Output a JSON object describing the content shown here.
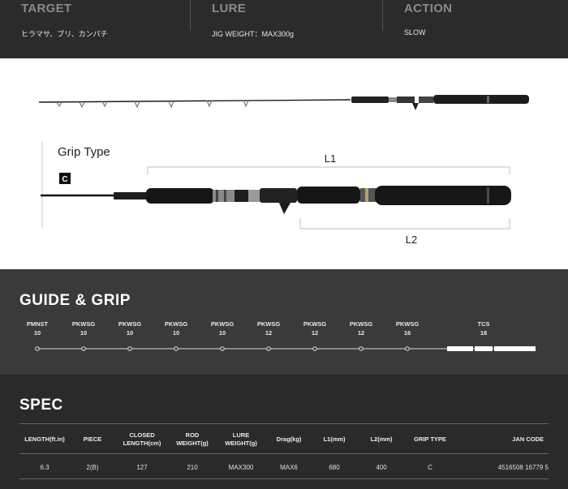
{
  "top": {
    "target": {
      "heading": "TARGET",
      "value": "ヒラマサ、ブリ、カンパチ"
    },
    "lure": {
      "heading": "LURE",
      "value": "JIG WEIGHT：MAX300g"
    },
    "action": {
      "heading": "ACTION",
      "value": "SLOW"
    }
  },
  "rod": {
    "grip_type_label": "Grip Type",
    "grip_type_code": "C",
    "l1_label": "L1",
    "l2_label": "L2"
  },
  "guide_grip": {
    "title": "GUIDE & GRIP",
    "guides": [
      {
        "type": "PMNST",
        "size": "10"
      },
      {
        "type": "PKWSG",
        "size": "10"
      },
      {
        "type": "PKWSG",
        "size": "10"
      },
      {
        "type": "PKWSG",
        "size": "10"
      },
      {
        "type": "PKWSG",
        "size": "10"
      },
      {
        "type": "PKWSG",
        "size": "12"
      },
      {
        "type": "PKWSG",
        "size": "12"
      },
      {
        "type": "PKWSG",
        "size": "12"
      },
      {
        "type": "PKWSG",
        "size": "16"
      },
      {
        "type": "TCS",
        "size": "18"
      }
    ]
  },
  "spec": {
    "title": "SPEC",
    "headers": [
      "LENGTH(ft.in)",
      "PIECE",
      "CLOSED\nLENGTH(cm)",
      "ROD\nWEIGHT(g)",
      "LURE\nWEIGHT(g)",
      "Drag(kg)",
      "L1(mm)",
      "L2(mm)",
      "GRIP TYPE",
      "JAN CODE"
    ],
    "rows": [
      [
        "6.3",
        "2(B)",
        "127",
        "210",
        "MAX300",
        "MAX6",
        "680",
        "400",
        "C",
        "4516508 16779 5"
      ]
    ]
  }
}
